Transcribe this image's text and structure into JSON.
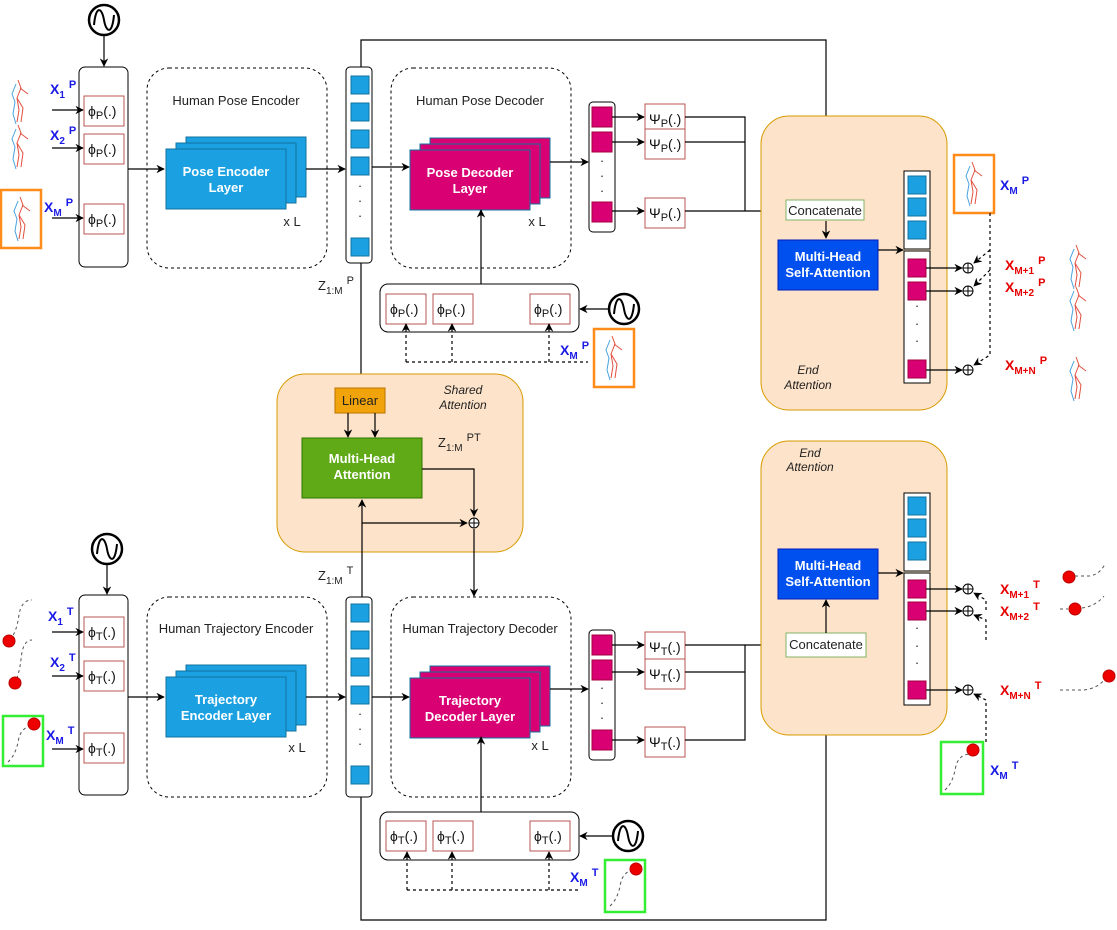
{
  "colors": {
    "encoder_blue": "#1ba1e2",
    "decoder_magenta": "#d80073",
    "attention_green": "#60a917",
    "linear_orange": "#f0a30a",
    "self_attention_blue": "#0050ef",
    "panel_peach": "#fde3c9",
    "panel_border": "#d79b00",
    "fn_box_border": "#b85450",
    "input_label_blue": "#1a1ae6",
    "output_label_red": "#e60000",
    "pose_frame_orange": "#ff8c1a",
    "traj_frame_green": "#33ee33"
  },
  "pose": {
    "input_labels": [
      {
        "base": "X",
        "sub": "1",
        "sup": "P"
      },
      {
        "base": "X",
        "sub": "2",
        "sup": "P"
      },
      {
        "base": "X",
        "sub": "M",
        "sup": "P"
      }
    ],
    "embed_fn": {
      "base": "ϕ",
      "sub": "P",
      "rest": "(.)"
    },
    "encoder_title": "Human Pose Encoder",
    "encoder_layer": [
      "Pose Encoder",
      "Layer"
    ],
    "decoder_title": "Human Pose Decoder",
    "decoder_layer": [
      "Pose Decoder",
      "Layer"
    ],
    "repeat": "x L",
    "latent": {
      "base": "Z",
      "sub": "1:M",
      "sup": "P"
    },
    "out_fn": {
      "base": "Ψ",
      "sub": "P",
      "rest": "(.)"
    },
    "concat": "Concatenate",
    "self_attn": [
      "Multi-Head",
      "Self-Attention"
    ],
    "end_attn": [
      "End",
      "Attention"
    ],
    "last_obs": {
      "base": "X",
      "sub": "M",
      "sup": "P"
    },
    "outputs": [
      {
        "base": "X",
        "sub": "M+1",
        "sup": "P"
      },
      {
        "base": "X",
        "sub": "M+2",
        "sup": "P"
      },
      {
        "base": "X",
        "sub": "M+N",
        "sup": "P"
      }
    ]
  },
  "traj": {
    "input_labels": [
      {
        "base": "X",
        "sub": "1",
        "sup": "T"
      },
      {
        "base": "X",
        "sub": "2",
        "sup": "T"
      },
      {
        "base": "X",
        "sub": "M",
        "sup": "T"
      }
    ],
    "embed_fn": {
      "base": "ϕ",
      "sub": "T",
      "rest": "(.)"
    },
    "encoder_title": "Human Trajectory Encoder",
    "encoder_layer": [
      "Trajectory",
      "Encoder Layer"
    ],
    "decoder_title": "Human Trajectory Decoder",
    "decoder_layer": [
      "Trajectory",
      "Decoder Layer"
    ],
    "repeat": "x L",
    "latent": {
      "base": "Z",
      "sub": "1:M",
      "sup": "T"
    },
    "out_fn": {
      "base": "Ψ",
      "sub": "T",
      "rest": "(.)"
    },
    "concat": "Concatenate",
    "self_attn": [
      "Multi-Head",
      "Self-Attention"
    ],
    "end_attn": [
      "End",
      "Attention"
    ],
    "last_obs": {
      "base": "X",
      "sub": "M",
      "sup": "T"
    },
    "outputs": [
      {
        "base": "X",
        "sub": "M+1",
        "sup": "T"
      },
      {
        "base": "X",
        "sub": "M+2",
        "sup": "T"
      },
      {
        "base": "X",
        "sub": "M+N",
        "sup": "T"
      }
    ]
  },
  "shared": {
    "title": [
      "Shared",
      "Attention"
    ],
    "linear": "Linear",
    "attn": [
      "Multi-Head",
      "Attention"
    ],
    "latent": {
      "base": "Z",
      "sub": "1:M",
      "sup": "PT"
    }
  },
  "ellipsis": "·"
}
